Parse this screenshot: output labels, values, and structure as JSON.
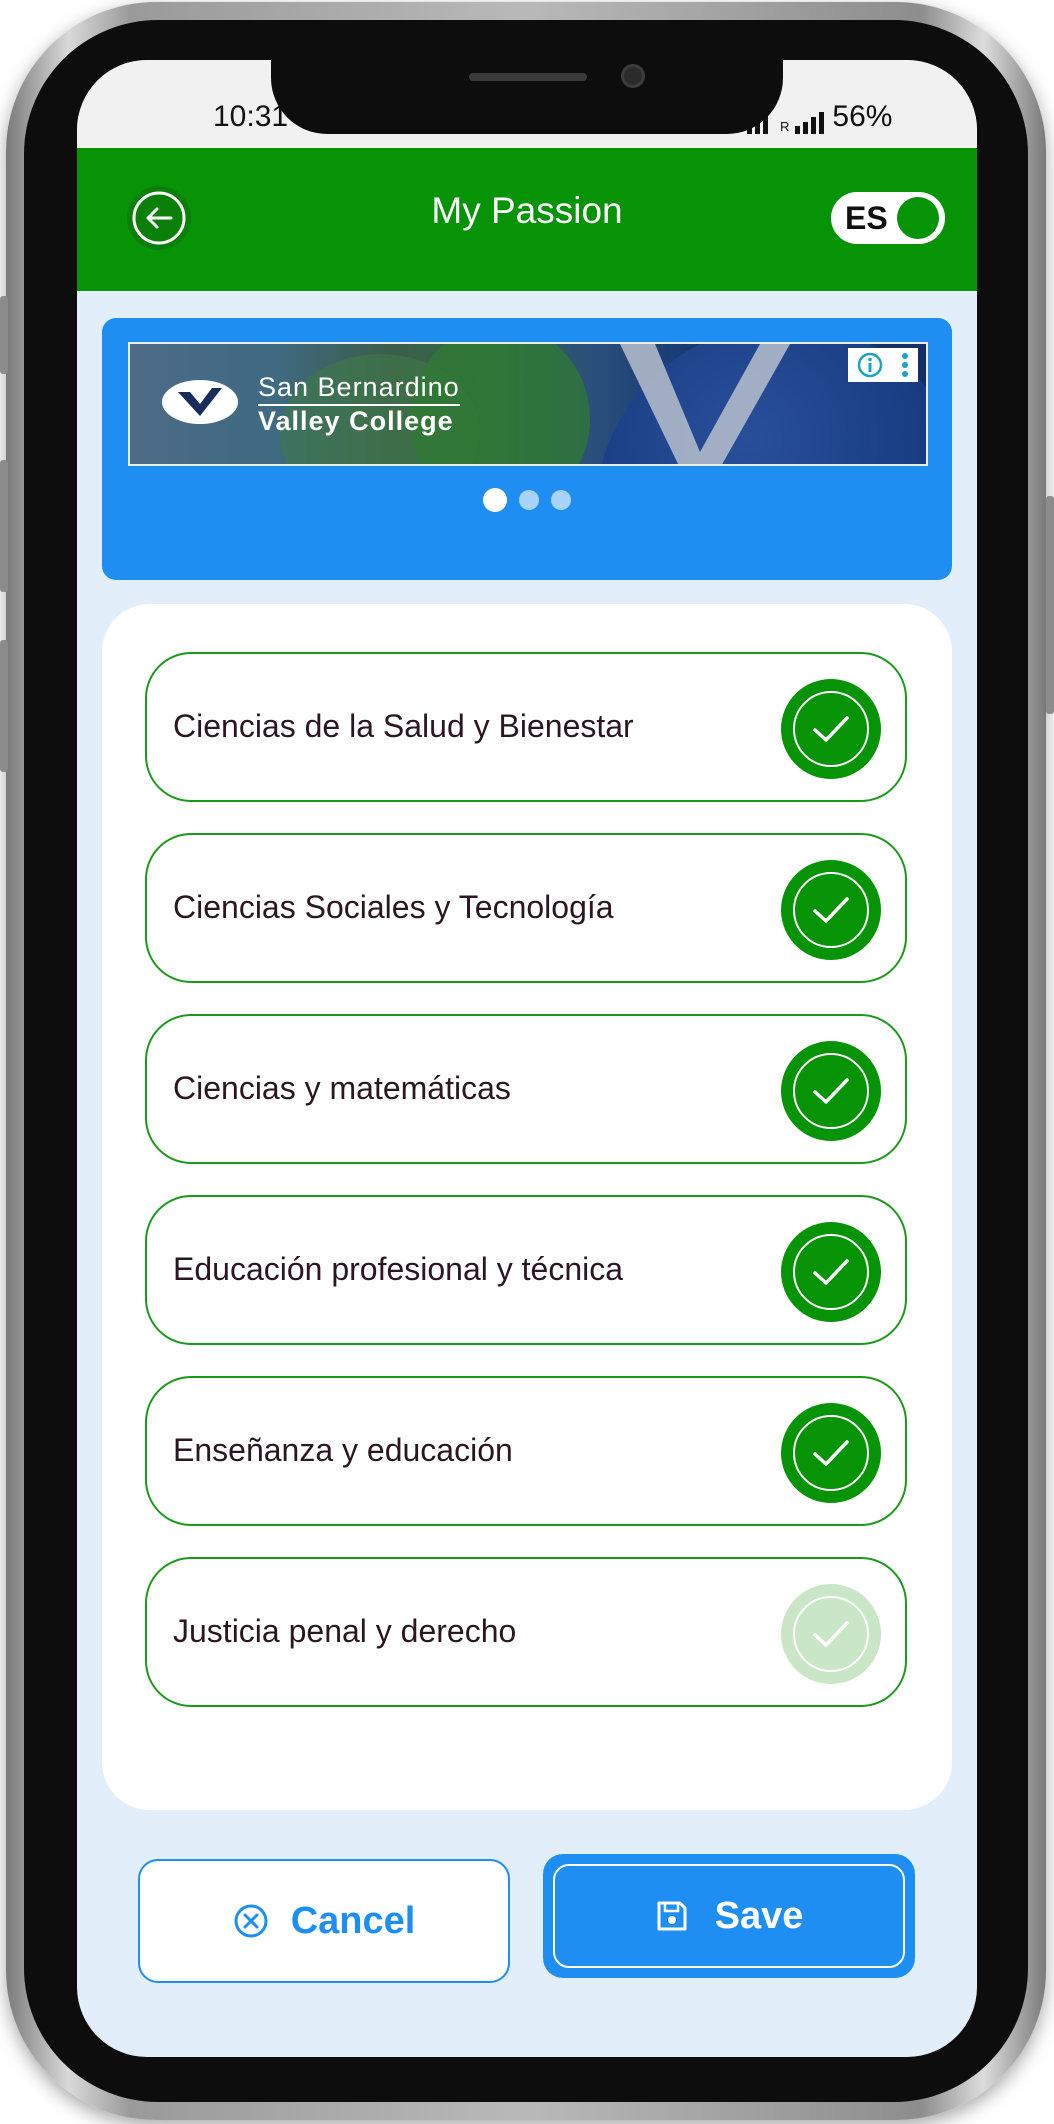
{
  "status_bar": {
    "time": "10:31",
    "battery": "56%",
    "network_label": "R"
  },
  "header": {
    "title": "My Passion",
    "language_toggle_label": "ES",
    "back_icon": "arrow-left-circle-icon",
    "background_color": "#069306"
  },
  "ad_banner": {
    "line1": "San Bernardino",
    "line2": "Valley College",
    "info_icon": "info-icon",
    "menu_icon": "more-vert-icon",
    "carousel_total": 3,
    "carousel_active": 1,
    "background_color": "#1e8ef3"
  },
  "passions": [
    {
      "label": "Ciencias de la Salud y Bienestar",
      "selected": true
    },
    {
      "label": "Ciencias Sociales y Tecnología",
      "selected": true
    },
    {
      "label": "Ciencias y matemáticas",
      "selected": true
    },
    {
      "label": "Educación profesional y técnica",
      "selected": true
    },
    {
      "label": "Enseñanza y educación",
      "selected": true
    },
    {
      "label": "Justicia penal y derecho",
      "selected": false
    }
  ],
  "footer": {
    "cancel_label": "Cancel",
    "cancel_icon": "x-circle-icon",
    "save_label": "Save",
    "save_icon": "floppy-disk-icon"
  },
  "colors": {
    "accent_green": "#069306",
    "accent_blue": "#1e8ef3",
    "unselected_check": "#c9e6c6"
  }
}
